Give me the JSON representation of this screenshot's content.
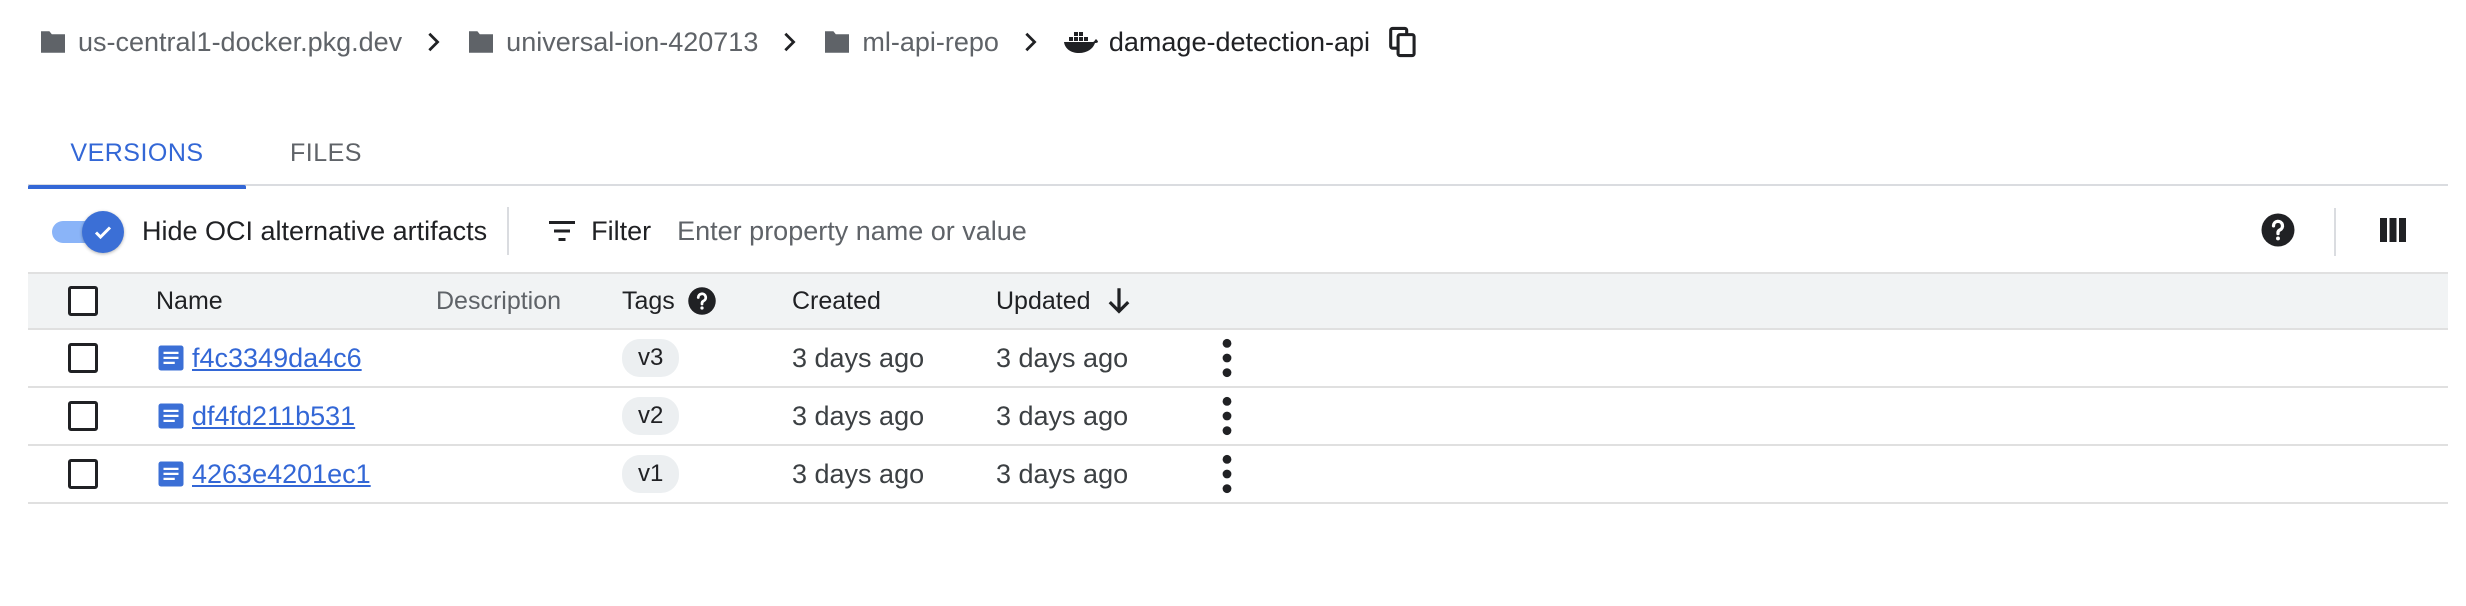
{
  "breadcrumb": {
    "items": [
      {
        "label": "us-central1-docker.pkg.dev",
        "icon": "folder-icon"
      },
      {
        "label": "universal-ion-420713",
        "icon": "folder-icon"
      },
      {
        "label": "ml-api-repo",
        "icon": "folder-icon"
      },
      {
        "label": "damage-detection-api",
        "icon": "docker-whale-icon"
      }
    ],
    "copy_icon": "copy-icon"
  },
  "tabs": [
    {
      "label": "VERSIONS",
      "active": true
    },
    {
      "label": "FILES",
      "active": false
    }
  ],
  "toolbar": {
    "toggle_label": "Hide OCI alternative artifacts",
    "toggle_on": true,
    "filter_label": "Filter",
    "filter_placeholder": "Enter property name or value",
    "help_icon": "help-icon",
    "columns_icon": "column-display-icon"
  },
  "table": {
    "headers": {
      "name": "Name",
      "description": "Description",
      "tags": "Tags",
      "created": "Created",
      "updated": "Updated"
    },
    "sort": {
      "column": "Updated",
      "direction": "descending"
    },
    "rows": [
      {
        "name": "f4c3349da4c6",
        "description": "",
        "tag": "v3",
        "created": "3 days ago",
        "updated": "3 days ago"
      },
      {
        "name": "df4fd211b531",
        "description": "",
        "tag": "v2",
        "created": "3 days ago",
        "updated": "3 days ago"
      },
      {
        "name": "4263e4201ec1",
        "description": "",
        "tag": "v1",
        "created": "3 days ago",
        "updated": "3 days ago"
      }
    ]
  },
  "colors": {
    "accent": "#3367d6",
    "icon": "#5f6368",
    "toggle_track": "#8ab4f8",
    "header_bg": "#f1f3f4"
  }
}
